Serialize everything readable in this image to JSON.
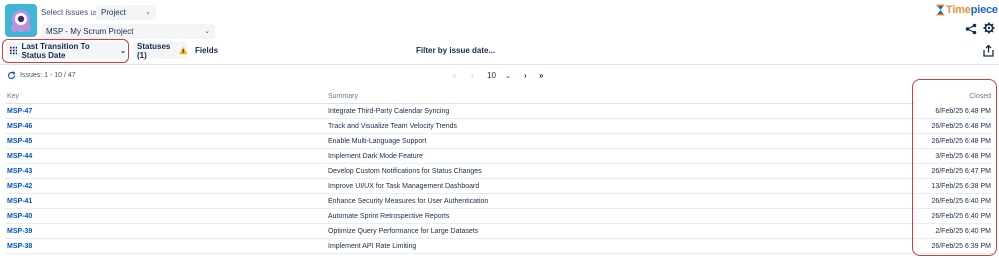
{
  "header": {
    "app_logo_icon": "timepiece-app-logo",
    "select_label": "Select issues using",
    "select_type_value": "Project",
    "select_scope_value": "MSP - My Scrum Project",
    "brand_name_part1": "Time",
    "brand_name_part2": "piece",
    "share_icon": "share-icon",
    "settings_icon": "gear-icon"
  },
  "toolbar": {
    "report_type_label": "Last Transition To Status Date",
    "statuses_label": "Statuses (1)",
    "fields_label": "Fields",
    "filter_label": "Filter by issue date...",
    "export_icon": "export-icon",
    "highlight_color": "#d93a3a"
  },
  "pagination": {
    "issue_count": "Issues: 1 - 10 / 47",
    "first": "«",
    "prev": "‹",
    "page_size": "10",
    "next": "›",
    "last": "»"
  },
  "table": {
    "columns": {
      "key": "Key",
      "summary": "Summary",
      "closed": "Closed"
    },
    "rows": [
      {
        "key": "MSP-47",
        "summary": "Integrate Third-Party Calendar Syncing",
        "closed": "6/Feb/25 6:48 PM"
      },
      {
        "key": "MSP-46",
        "summary": "Track and Visualize Team Velocity Trends",
        "closed": "26/Feb/25 6:48 PM"
      },
      {
        "key": "MSP-45",
        "summary": "Enable Multi-Language Support",
        "closed": "26/Feb/25 6:48 PM"
      },
      {
        "key": "MSP-44",
        "summary": "Implement Dark Mode Feature",
        "closed": "3/Feb/25 6:48 PM"
      },
      {
        "key": "MSP-43",
        "summary": "Develop Custom Notifications for Status Changes",
        "closed": "26/Feb/25 6:47 PM"
      },
      {
        "key": "MSP-42",
        "summary": "Improve UI/UX for Task Management Dashboard",
        "closed": "13/Feb/25 6:38 PM"
      },
      {
        "key": "MSP-41",
        "summary": "Enhance Security Measures for User Authentication",
        "closed": "26/Feb/25 6:40 PM"
      },
      {
        "key": "MSP-40",
        "summary": "Automate Sprint Retrospective Reports",
        "closed": "26/Feb/25 6:40 PM"
      },
      {
        "key": "MSP-39",
        "summary": "Optimize Query Performance for Large Datasets",
        "closed": "2/Feb/25 6:40 PM"
      },
      {
        "key": "MSP-38",
        "summary": "Implement API Rate Limiting",
        "closed": "26/Feb/25 6:39 PM"
      }
    ]
  },
  "colors": {
    "link": "#0052cc",
    "accent_orange": "#f08c2e",
    "accent_blue": "#1f64c8",
    "warning": "#ffab00"
  }
}
